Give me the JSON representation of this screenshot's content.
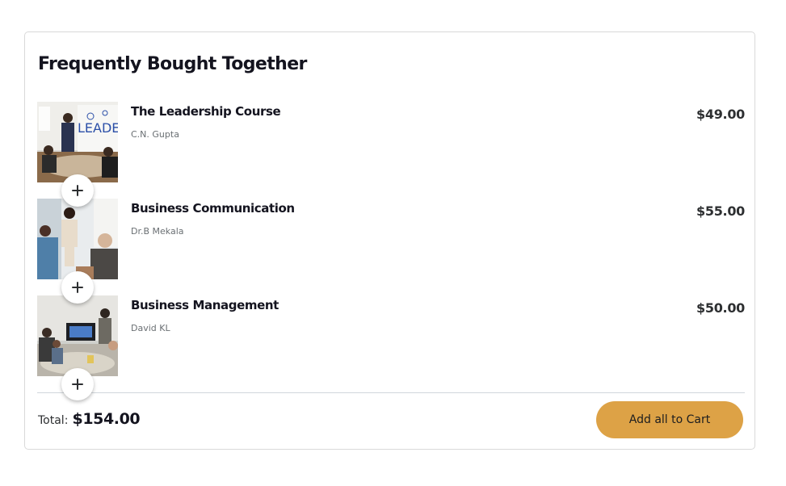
{
  "section": {
    "title": "Frequently Bought Together"
  },
  "items": [
    {
      "title": "The Leadership Course",
      "author": "C.N. Gupta",
      "price": "$49.00",
      "image": "leadership-presentation"
    },
    {
      "title": "Business Communication",
      "author": "Dr.B Mekala",
      "price": "$55.00",
      "image": "business-meeting"
    },
    {
      "title": "Business Management",
      "author": "David KL",
      "price": "$50.00",
      "image": "conference-room"
    }
  ],
  "footer": {
    "total_label": "Total:",
    "total_value": "$154.00",
    "cart_button_label": "Add all to Cart"
  },
  "colors": {
    "accent": "#dda246",
    "text": "#14141f",
    "muted": "#6a6f73",
    "border": "#d9d9d9"
  },
  "icons": {
    "add": "plus-icon"
  }
}
